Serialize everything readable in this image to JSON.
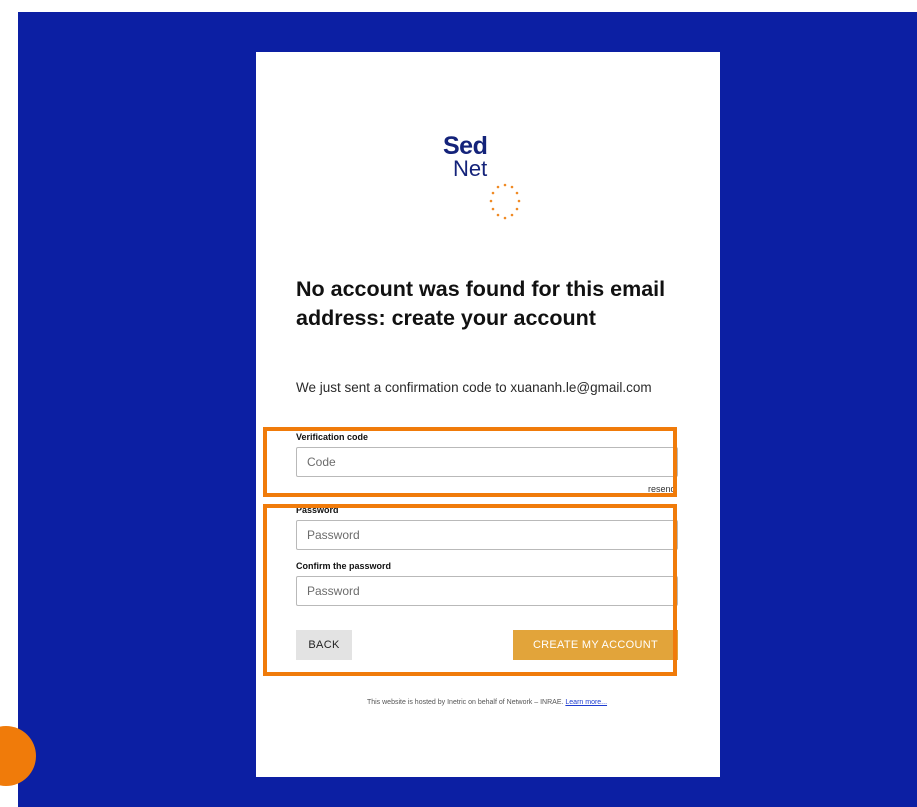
{
  "logo": {
    "word_top": "Sed",
    "word_bottom": "Net",
    "icon": "dotted-circle-logo-icon",
    "text_color": "#14237a",
    "dot_color": "#f08a24"
  },
  "form": {
    "heading": "No account was found for this email address: create your account",
    "subtext": "We just sent a confirmation code to xuananh.le@gmail.com",
    "verification": {
      "label": "Verification code",
      "placeholder": "Code",
      "resend_label": "resend"
    },
    "password": {
      "label": "Password",
      "placeholder": "Password"
    },
    "confirm_password": {
      "label": "Confirm the password",
      "placeholder": "Password"
    },
    "back_button": "BACK",
    "create_button": "CREATE MY ACCOUNT",
    "footer_text": "This website is hosted by Inetric on behalf of Network – INRAE.",
    "footer_link": "Learn more..."
  },
  "colors": {
    "backdrop": "#0c1fa3",
    "card": "#ffffff",
    "accent_button": "#e2a43a",
    "highlight": "#f07b0a"
  }
}
